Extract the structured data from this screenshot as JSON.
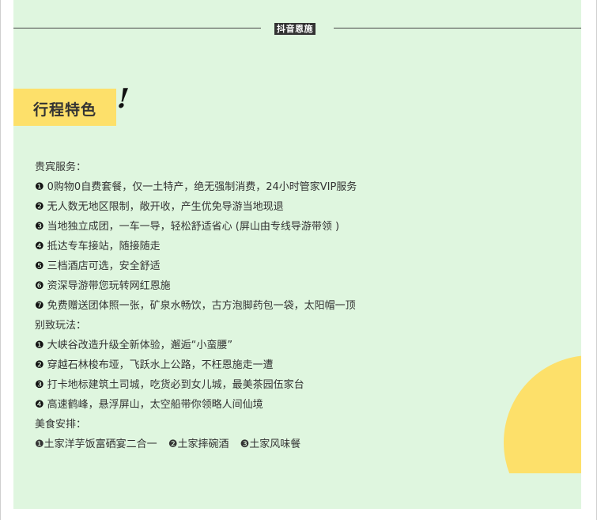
{
  "header": {
    "brand_tag": "抖音恩施"
  },
  "section": {
    "title": "行程特色",
    "exclaim": "!"
  },
  "vip": {
    "heading": "贵宾服务：",
    "items": [
      {
        "num": "❶",
        "text": "0购物0自费套餐，仅一土特产，绝无强制消费，24小时管家VIP服务"
      },
      {
        "num": "❷",
        "text": "无人数无地区限制，敞开收，产生优免导游当地现退"
      },
      {
        "num": "❸",
        "text": "当地独立成团，一车一导，轻松舒适省心 (屏山由专线导游带领 )"
      },
      {
        "num": "❹",
        "text": "抵达专车接站，随接随走"
      },
      {
        "num": "❺",
        "text": "三档酒店可选，安全舒适"
      },
      {
        "num": "❻",
        "text": "资深导游带您玩转网红恩施"
      },
      {
        "num": "❼",
        "text": "免费赠送团体照一张，矿泉水畅饮，古方泡脚药包一袋，太阳帽一顶"
      }
    ]
  },
  "play": {
    "heading": "别致玩法：",
    "items": [
      {
        "num": "❶",
        "text": "大峡谷改造升级全新体验，邂逅“小蛮腰”"
      },
      {
        "num": "❷",
        "text": "穿越石林梭布垭，飞跃水上公路，不枉恩施走一遭"
      },
      {
        "num": "❸",
        "text": "打卡地标建筑土司城，吃货必到女儿城，最美茶园伍家台"
      },
      {
        "num": "❹",
        "text": "高速鹤峰，悬浮屏山，太空船带你领略人间仙境"
      }
    ]
  },
  "food": {
    "heading": "美食安排：",
    "items": [
      {
        "num": "❶",
        "text": "土家洋芋饭富硒宴二合一"
      },
      {
        "num": "❷",
        "text": "土家摔碗酒"
      },
      {
        "num": "❸",
        "text": "土家风味餐"
      }
    ]
  },
  "colors": {
    "panel_bg": "#dff6df",
    "accent_yellow": "#fde06a"
  }
}
